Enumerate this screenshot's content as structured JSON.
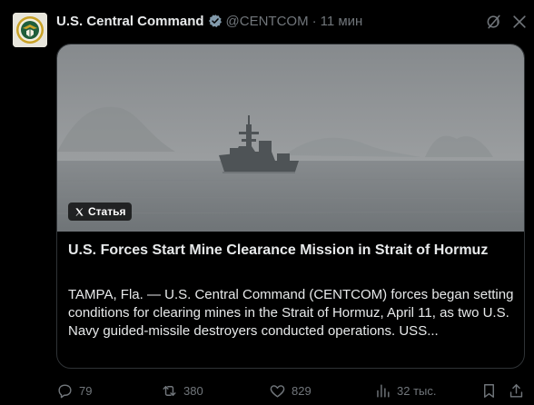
{
  "author": {
    "name": "U.S. Central Command",
    "handle": "@CENTCOM",
    "separator": "·",
    "time": "11 мин",
    "verified_color": "#829aab"
  },
  "icons": {
    "verified": "verified-badge-icon",
    "grok": "grok-icon",
    "more": "more-icon",
    "x_logo": "x-logo-icon",
    "reply": "reply-icon",
    "repost": "repost-icon",
    "like": "like-icon",
    "views": "views-icon",
    "bookmark": "bookmark-icon",
    "share": "share-icon"
  },
  "card": {
    "badge_label": "Статья",
    "title": "U.S. Forces Start Mine Clearance Mission in Strait of Hormuz",
    "description": "TAMPA, Fla. — U.S. Central Command (CENTCOM) forces began setting conditions for clearing mines in the Strait of Hormuz, April 11, as two U.S. Navy guided-missile destroyers conducted operations. USS..."
  },
  "actions": {
    "replies": "79",
    "reposts": "380",
    "likes": "829",
    "views": "32 тыс."
  },
  "colors": {
    "background": "#000000",
    "text_primary": "#e7e9ea",
    "text_secondary": "#71767b",
    "border": "#2f3336"
  }
}
